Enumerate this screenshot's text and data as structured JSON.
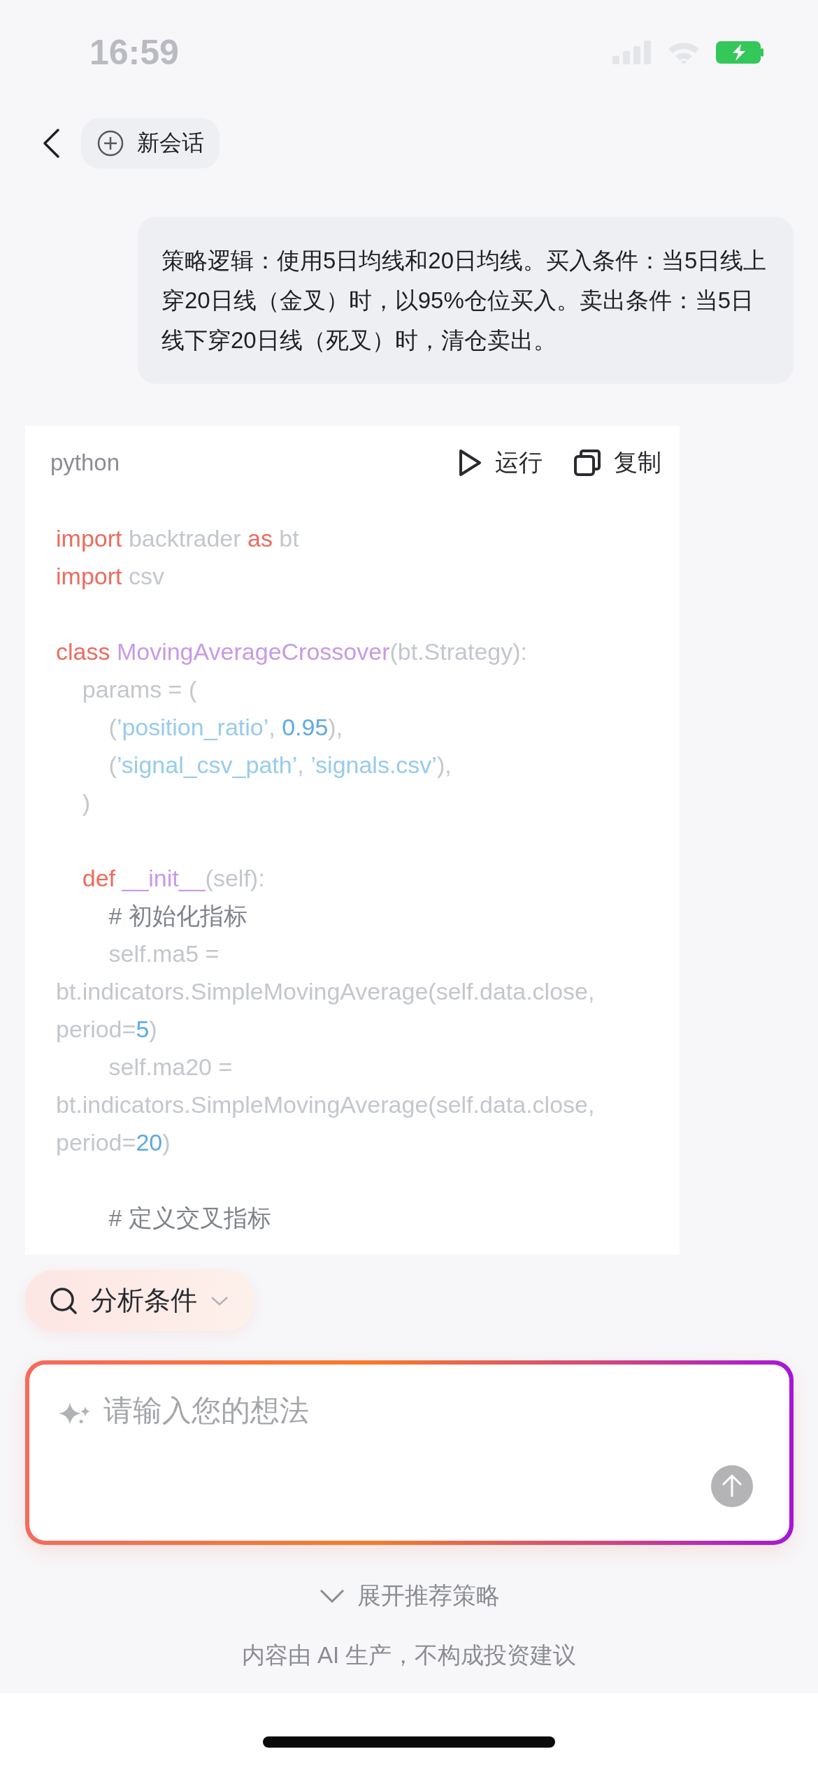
{
  "status_bar": {
    "time": "16:59"
  },
  "nav": {
    "new_chat": "新会话"
  },
  "user_message": "策略逻辑：使用5日均线和20日均线。买入条件：当5日线上穿20日线（金叉）时，以95%仓位买入。卖出条件：当5日线下穿20日线（死叉）时，清仓卖出。",
  "code_block": {
    "language": "python",
    "run": "运行",
    "copy": "复制",
    "lines": [
      {
        "kind": "code",
        "tokens": [
          {
            "text": "import",
            "kind": "keyword"
          },
          {
            "text": " backtrader ",
            "kind": "plain"
          },
          {
            "text": "as",
            "kind": "keyword"
          },
          {
            "text": " bt",
            "kind": "plain"
          }
        ]
      },
      {
        "kind": "code",
        "tokens": [
          {
            "text": "import",
            "kind": "keyword"
          },
          {
            "text": " csv",
            "kind": "plain"
          }
        ]
      },
      {
        "kind": "blank"
      },
      {
        "kind": "code",
        "tokens": [
          {
            "text": "class ",
            "kind": "keyword"
          },
          {
            "text": "MovingAverageCrossover",
            "kind": "name"
          },
          {
            "text": "(bt.Strategy):",
            "kind": "plain"
          }
        ]
      },
      {
        "kind": "code",
        "tokens": [
          {
            "text": "    params = (",
            "kind": "plain"
          }
        ]
      },
      {
        "kind": "code",
        "tokens": [
          {
            "text": "        (",
            "kind": "plain"
          },
          {
            "text": "’position_ratio’",
            "kind": "string"
          },
          {
            "text": ", ",
            "kind": "plain"
          },
          {
            "text": "0.95",
            "kind": "number"
          },
          {
            "text": "),",
            "kind": "plain"
          }
        ]
      },
      {
        "kind": "code",
        "tokens": [
          {
            "text": "        (",
            "kind": "plain"
          },
          {
            "text": "’signal_csv_path’",
            "kind": "string"
          },
          {
            "text": ", ",
            "kind": "plain"
          },
          {
            "text": "’signals.csv’",
            "kind": "string"
          },
          {
            "text": "),",
            "kind": "plain"
          }
        ]
      },
      {
        "kind": "code",
        "tokens": [
          {
            "text": "    )",
            "kind": "plain"
          }
        ]
      },
      {
        "kind": "blank"
      },
      {
        "kind": "code",
        "tokens": [
          {
            "text": "    def ",
            "kind": "keyword"
          },
          {
            "text": "__init__",
            "kind": "name"
          },
          {
            "text": "(self):",
            "kind": "plain"
          }
        ]
      },
      {
        "kind": "code",
        "tokens": [
          {
            "text": "        # 初始化指标",
            "kind": "comment"
          }
        ]
      },
      {
        "kind": "code",
        "tokens": [
          {
            "text": "        self.ma5 =",
            "kind": "plain"
          }
        ]
      },
      {
        "kind": "code",
        "tokens": [
          {
            "text": "bt.indicators.SimpleMovingAverage(self.data.close,",
            "kind": "plain"
          }
        ]
      },
      {
        "kind": "code",
        "tokens": [
          {
            "text": "period=",
            "kind": "plain"
          },
          {
            "text": "5",
            "kind": "number"
          },
          {
            "text": ")",
            "kind": "plain"
          }
        ]
      },
      {
        "kind": "code",
        "tokens": [
          {
            "text": "        self.ma20 =",
            "kind": "plain"
          }
        ]
      },
      {
        "kind": "code",
        "tokens": [
          {
            "text": "bt.indicators.SimpleMovingAverage(self.data.close,",
            "kind": "plain"
          }
        ]
      },
      {
        "kind": "code",
        "tokens": [
          {
            "text": "period=",
            "kind": "plain"
          },
          {
            "text": "20",
            "kind": "number"
          },
          {
            "text": ")",
            "kind": "plain"
          }
        ]
      },
      {
        "kind": "blank"
      },
      {
        "kind": "code",
        "tokens": [
          {
            "text": "        # 定义交叉指标",
            "kind": "comment"
          }
        ]
      }
    ]
  },
  "chip": {
    "label": "分析条件"
  },
  "input": {
    "placeholder": "请输入您的想法"
  },
  "expand_link": "展开推荐策略",
  "disclaimer": "内容由 AI 生产，不构成投资建议"
}
